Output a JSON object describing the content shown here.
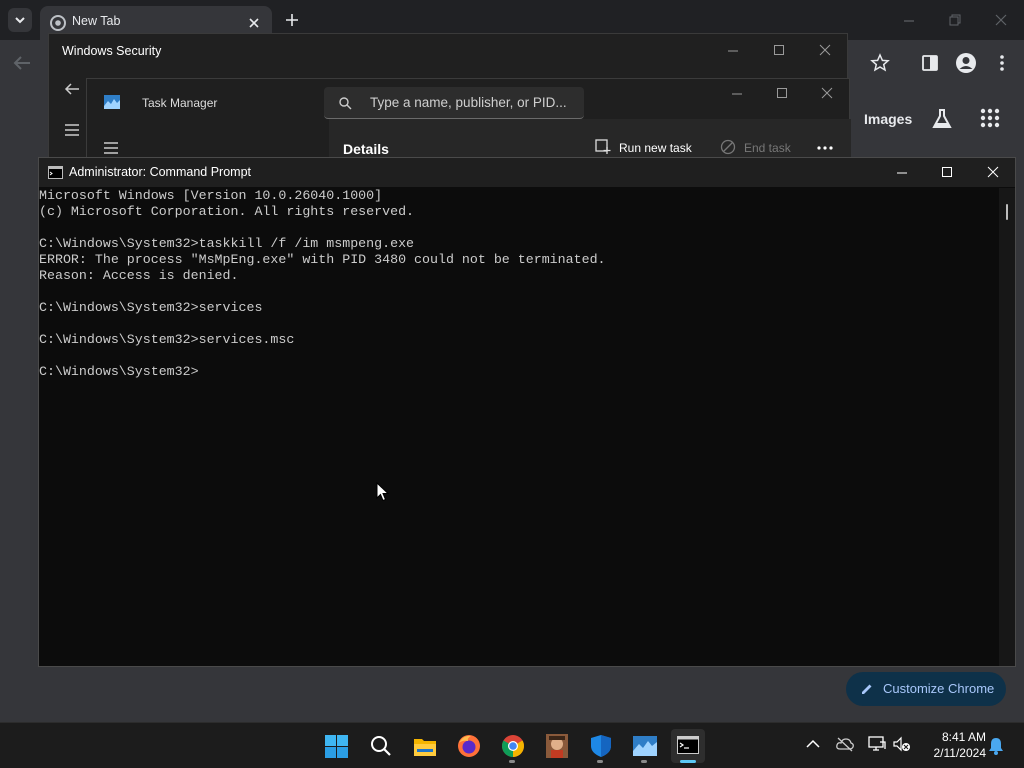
{
  "chrome": {
    "tab_title": "New Tab",
    "images_link": "Images",
    "customize_label": "Customize Chrome"
  },
  "windows_security": {
    "title": "Windows Security"
  },
  "task_manager": {
    "title": "Task Manager",
    "search_placeholder": "Type a name, publisher, or PID...",
    "section": "Details",
    "run_new_task": "Run new task",
    "end_task": "End task"
  },
  "cmd": {
    "title": "Administrator: Command Prompt",
    "lines": [
      "Microsoft Windows [Version 10.0.26040.1000]",
      "(c) Microsoft Corporation. All rights reserved.",
      "",
      "C:\\Windows\\System32>taskkill /f /im msmpeng.exe",
      "ERROR: The process \"MsMpEng.exe\" with PID 3480 could not be terminated.",
      "Reason: Access is denied.",
      "",
      "C:\\Windows\\System32>services",
      "",
      "C:\\Windows\\System32>services.msc",
      "",
      "C:\\Windows\\System32>"
    ]
  },
  "taskbar": {
    "time": "8:41 AM",
    "date": "2/11/2024",
    "apps": [
      "start-icon",
      "search-icon",
      "file-explorer-icon",
      "firefox-icon",
      "chrome-icon",
      "game-app-icon",
      "windows-security-icon",
      "task-manager-icon",
      "command-prompt-icon"
    ]
  },
  "colors": {
    "accent": "#5cc8f5",
    "cmd_text": "#cccccc",
    "chrome_bg": "#35363a"
  }
}
